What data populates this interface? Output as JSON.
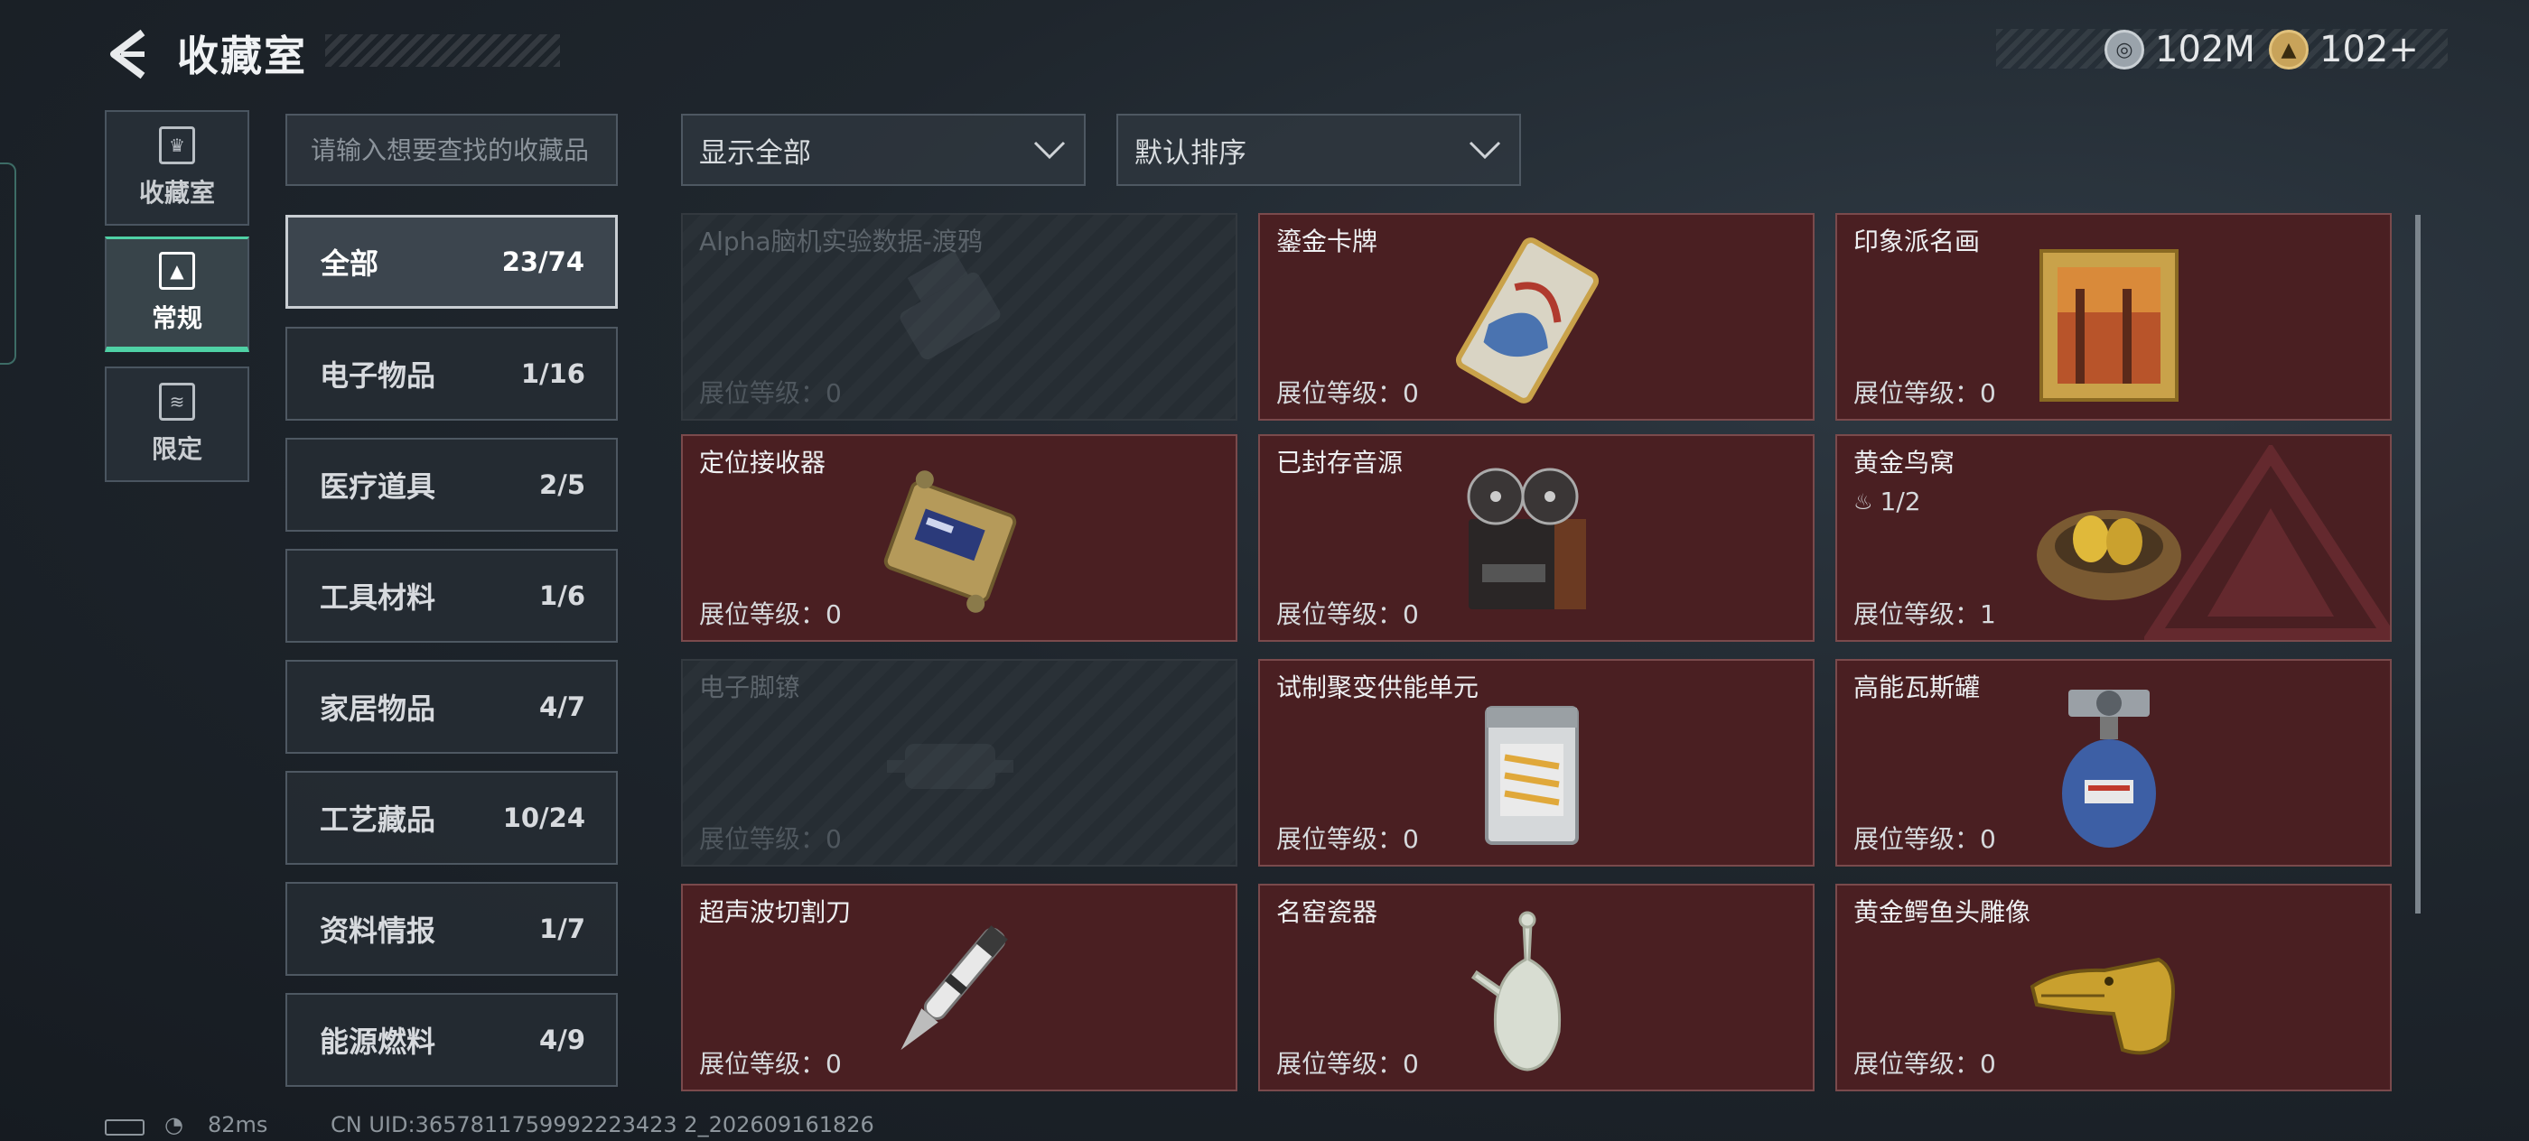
{
  "header": {
    "title": "收藏室",
    "currency": [
      {
        "icon": "silver-coin-icon",
        "value": "102M"
      },
      {
        "icon": "gold-triangle-coin-icon",
        "value": "102+"
      }
    ]
  },
  "nav_tabs": [
    {
      "label": "收藏室",
      "icon": "trophy-icon"
    },
    {
      "label": "常规",
      "icon": "image-frame-icon",
      "active": true
    },
    {
      "label": "限定",
      "icon": "card-icon"
    }
  ],
  "search": {
    "placeholder": "请输入想要查找的收藏品"
  },
  "filter": {
    "selected": "显示全部"
  },
  "sort": {
    "selected": "默认排序"
  },
  "categories": [
    {
      "name": "全部",
      "count": "23/74",
      "active": true
    },
    {
      "name": "电子物品",
      "count": "1/16"
    },
    {
      "name": "医疗道具",
      "count": "2/5"
    },
    {
      "name": "工具材料",
      "count": "1/6"
    },
    {
      "name": "家居物品",
      "count": "4/7"
    },
    {
      "name": "工艺藏品",
      "count": "10/24"
    },
    {
      "name": "资料情报",
      "count": "1/7"
    },
    {
      "name": "能源燃料",
      "count": "4/9"
    }
  ],
  "level_label": "展位等级：",
  "items": [
    {
      "name": "Alpha脑机实验数据-渡鸦",
      "level": "0",
      "owned": false,
      "icon": "data-drive-icon"
    },
    {
      "name": "鎏金卡牌",
      "level": "0",
      "owned": true,
      "icon": "gilded-card-icon"
    },
    {
      "name": "印象派名画",
      "level": "0",
      "owned": true,
      "icon": "framed-painting-icon"
    },
    {
      "name": "定位接收器",
      "level": "0",
      "owned": true,
      "icon": "gps-receiver-icon"
    },
    {
      "name": "已封存音源",
      "level": "0",
      "owned": true,
      "icon": "reel-recorder-icon"
    },
    {
      "name": "黄金鸟窝",
      "level": "1",
      "owned": true,
      "icon": "golden-nest-icon",
      "progress": "1/2"
    },
    {
      "name": "电子脚镣",
      "level": "0",
      "owned": false,
      "icon": "ankle-monitor-icon"
    },
    {
      "name": "试制聚变供能单元",
      "level": "0",
      "owned": true,
      "icon": "fusion-cell-icon"
    },
    {
      "name": "高能瓦斯罐",
      "level": "0",
      "owned": true,
      "icon": "gas-canister-icon"
    },
    {
      "name": "超声波切割刀",
      "level": "0",
      "owned": true,
      "icon": "ultrasonic-knife-icon"
    },
    {
      "name": "名窑瓷器",
      "level": "0",
      "owned": true,
      "icon": "porcelain-vase-icon"
    },
    {
      "name": "黄金鳄鱼头雕像",
      "level": "0",
      "owned": true,
      "icon": "gold-crocodile-icon"
    }
  ],
  "status_bar": {
    "ping": "82ms",
    "uid": "CN UID:3657811759992223423 2_202609161826"
  },
  "colors": {
    "owned_card": "#4a1f22",
    "accent_green": "#4fd1a5",
    "panel": "#262d33"
  }
}
